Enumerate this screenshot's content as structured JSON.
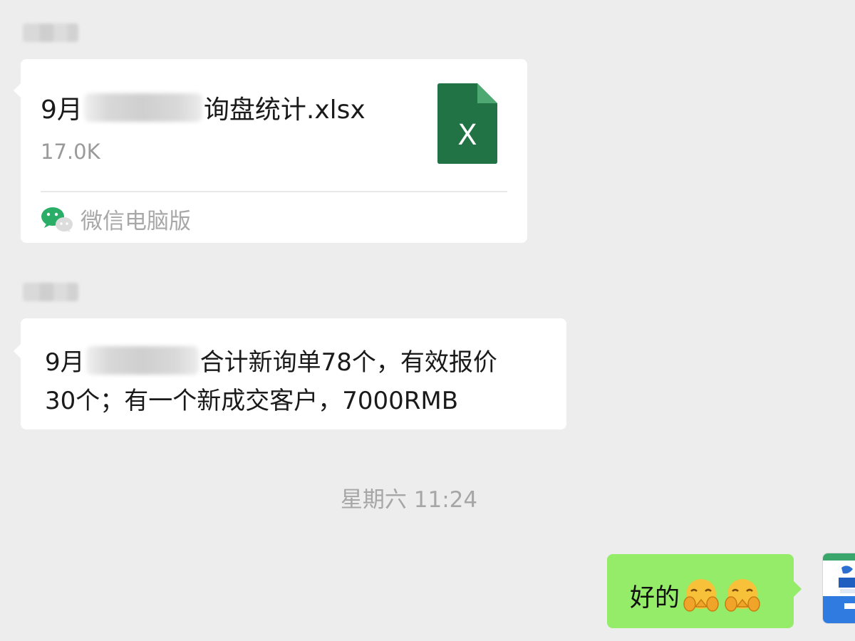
{
  "messages": {
    "file_card": {
      "file_name_prefix": "9月",
      "file_name_suffix": "询盘统计.xlsx",
      "file_size": "17.0K",
      "source_label": "微信电脑版",
      "file_icon_letter": "X"
    },
    "text_message": {
      "line1_prefix": "9月",
      "line1_suffix": "合计新询单78个，有效报价",
      "line2": "30个；有一个新成交客户，7000RMB"
    },
    "timestamp": "星期六 11:24",
    "my_reply": {
      "text": "好的"
    }
  },
  "colors": {
    "background": "#ededed",
    "bubble_incoming": "#ffffff",
    "bubble_outgoing": "#95ec69",
    "excel_green": "#217346",
    "wechat_green": "#2aae67"
  },
  "icons": {
    "file": "excel-file-icon",
    "source": "wechat-icon",
    "emoji": "pleading-hands-emoji"
  }
}
